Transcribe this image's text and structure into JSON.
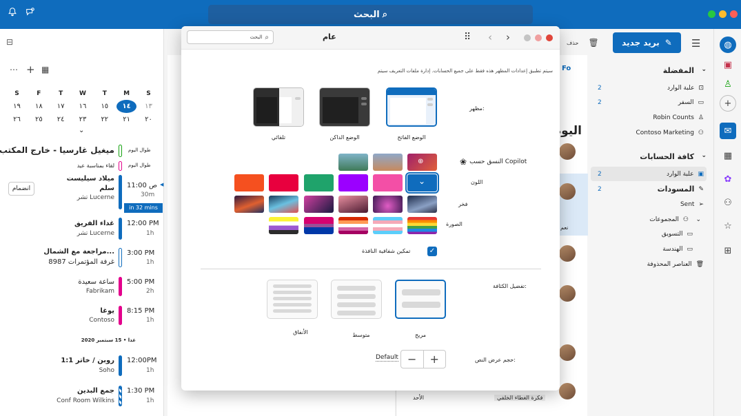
{
  "topbar": {
    "search": "البحث"
  },
  "folders": {
    "new_mail": "بريد جديد",
    "favorites": "المفضلة",
    "fav_items": [
      {
        "label": "علبة الوارد",
        "count": "2"
      },
      {
        "label": "السفر",
        "count": "2"
      },
      {
        "label": "Robin Counts",
        "count": ""
      },
      {
        "label": "Contoso Marketing",
        "count": ""
      }
    ],
    "all_accounts": "كافة الحسابات",
    "acc_items": [
      {
        "label": "علبة الوارد",
        "count": "2"
      },
      {
        "label": "المسودات",
        "count": "2"
      },
      {
        "label": "Sent",
        "count": ""
      },
      {
        "label": "المجموعات",
        "count": ""
      },
      {
        "label": "التسويق",
        "count": ""
      },
      {
        "label": "الهندسة",
        "count": ""
      },
      {
        "label": "العناصر المحذوفة",
        "count": ""
      }
    ],
    "delete_label": "حذف"
  },
  "msglist": {
    "today": "اليوم",
    "tab": "Fo",
    "snippet1": "نعم",
    "snippet2": "فكرة الغطاء الخلفي",
    "date": "الأحد"
  },
  "calendar": {
    "weekdays": [
      "S",
      "M",
      "T",
      "W",
      "T",
      "F",
      "S"
    ],
    "weeks": [
      [
        "١٣",
        "١٤",
        "١٥",
        "١٦",
        "١٧",
        "١٨",
        "١٩"
      ],
      [
        "٢٠",
        "٢١",
        "٢٢",
        "٢٣",
        "٢٤",
        "٢٥",
        "٢٦"
      ]
    ],
    "allday": [
      {
        "label": "طوال اليوم",
        "title": "ميغيل غارسيا - خارج المكتب"
      },
      {
        "label": "طوال اليوم",
        "title": "لقاء بمناسبة عيد"
      }
    ],
    "events": [
      {
        "time": "11:00 ص",
        "dur": "30m",
        "title": "ميلاد سيليست",
        "title2": "سلم",
        "loc": "تشر Lucerne",
        "join": "انضمام",
        "badge": "in 32 mins"
      },
      {
        "time": "12:00 PM",
        "dur": "1h",
        "title": "غداء الفريق",
        "loc": "تشر Lucerne"
      },
      {
        "time": "3:00 PM",
        "dur": "1h",
        "title": "مراجعة مع الشمال...",
        "loc": "غرفة المؤتمرات 8987"
      },
      {
        "time": "5:00 PM",
        "dur": "2h",
        "title": "ساعة سعيدة",
        "loc": "Fabrikam"
      },
      {
        "time": "8:15 PM",
        "dur": "1h",
        "title": "يوغا",
        "loc": "Contoso"
      },
      {
        "time": "12:00PM",
        "dur": "1h",
        "title": "1:1 روبن / خاتر",
        "loc": "Soho"
      },
      {
        "time": "1:30 PM",
        "dur": "1h",
        "title": "جمع البدين",
        "loc": "Conf Room Wilkins"
      }
    ],
    "tomorrow": "غدا • 15 سبتمبر 2020"
  },
  "dialog": {
    "search": "البحث",
    "title": "عام",
    "note": "سيتم تطبيق إعدادات المظهر هذه فقط على جميع الحسابات. إدارة ملفات التعريف سيتم",
    "appearance_label": "مظهر:",
    "themes": [
      {
        "caption": "الوضع الفاتح"
      },
      {
        "caption": "الوضع الداكن"
      },
      {
        "caption": "تلقائي"
      }
    ],
    "copilot_label": "النسق حسب Copilot",
    "color_label": "اللون",
    "pride_label": "فخر",
    "image_label": "الصورة",
    "transparency_label": "تمكين شفافية النافذة",
    "density_label": "تفضيل الكثافة:",
    "densities": [
      {
        "caption": "مريح"
      },
      {
        "caption": "متوسط"
      },
      {
        "caption": "الأنفاق"
      }
    ],
    "text_size_label": "حجم عرض النص:",
    "text_size_value": "Default",
    "colors": [
      "#0f6cbd",
      "#f34fa6",
      "#9b00ff",
      "#1fa36b",
      "#e8003e",
      "#f5501f"
    ]
  }
}
